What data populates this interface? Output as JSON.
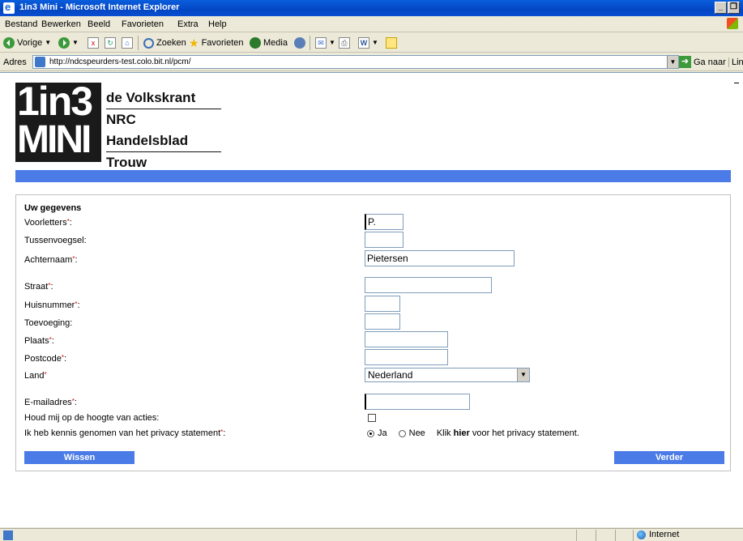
{
  "window": {
    "title": "1in3 Mini - Microsoft Internet Explorer",
    "minimize": "_",
    "restore": "❐"
  },
  "menu": [
    "Bestand",
    "Bewerken",
    "Beeld",
    "Favorieten",
    "Extra",
    "Help"
  ],
  "toolbar": {
    "back": "Vorige",
    "search": "Zoeken",
    "favorites": "Favorieten",
    "media": "Media"
  },
  "address": {
    "label": "Adres",
    "url": "http://ndcspeurders-test.colo.bit.nl/pcm/",
    "go": "Ga naar",
    "links": "Lin"
  },
  "logo": {
    "line1": "1in3",
    "line2": "MINI",
    "papers": [
      "de Volkskrant",
      "NRC Handelsblad",
      "Trouw"
    ]
  },
  "form": {
    "heading": "Uw gegevens",
    "labels": {
      "voorletters": "Voorletters",
      "tussenvoegsel": "Tussenvoegsel:",
      "achternaam": "Achternaam",
      "straat": "Straat",
      "huisnummer": "Huisnummer",
      "toevoeging": "Toevoeging:",
      "plaats": "Plaats",
      "postcode": "Postcode",
      "land": "Land",
      "email": "E-mailadres",
      "houd": "Houd mij op de hoogte van acties:",
      "privacy": "Ik heb kennis genomen van het privacy statement"
    },
    "values": {
      "voorletters": "P.",
      "tussenvoegsel": "",
      "achternaam": "Pietersen",
      "straat": "",
      "huisnummer": "",
      "toevoeging": "",
      "plaats": "",
      "postcode": "",
      "land": "Nederland",
      "email": ""
    },
    "required_mark": "*",
    "colon": ":",
    "radio": {
      "yes": "Ja",
      "no": "Nee",
      "selected": "Ja",
      "klik": "Klik ",
      "hier": "hier",
      "rest": " voor het privacy statement."
    },
    "newsletter_checked": false,
    "buttons": {
      "reset": "Wissen",
      "next": "Verder"
    }
  },
  "status": {
    "zone": "Internet"
  }
}
